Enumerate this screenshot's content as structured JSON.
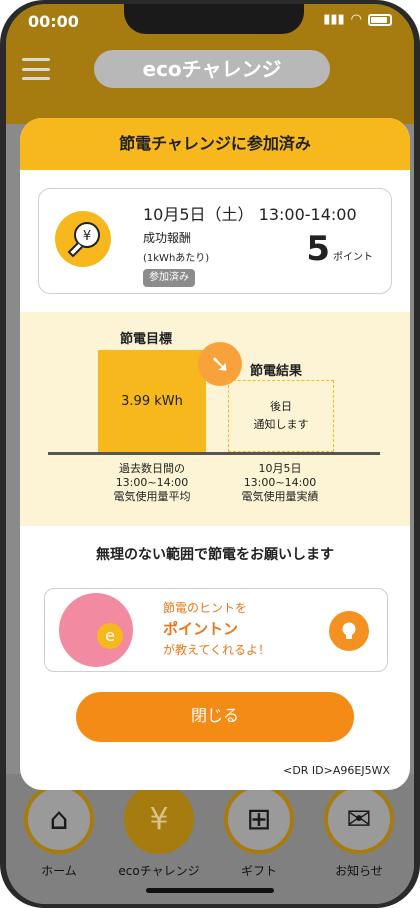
{
  "status": {
    "time": "00:00"
  },
  "header": {
    "title": "ecoチャレンジ"
  },
  "modal": {
    "title": "節電チャレンジに参加済み",
    "event": {
      "date": "10月5日（土）",
      "time": "13:00-14:00",
      "reward_label": "成功報酬",
      "reward_unit": "(1kWhあたり)",
      "status_badge": "参加済み",
      "points": "5",
      "points_unit": "ポイント"
    },
    "goal": {
      "goal_label": "節電目標",
      "goal_value": "3.99 kWh",
      "result_label": "節電結果",
      "result_line1": "後日",
      "result_line2": "通知します",
      "left_caption": [
        "過去数日間の",
        "13:00~14:00",
        "電気使用量平均"
      ],
      "right_caption": [
        "10月5日",
        "13:00~14:00",
        "電気使用量実績"
      ]
    },
    "request": "無理のない範囲で節電をお願いします",
    "tip": {
      "line1": "節電のヒントを",
      "line2": "ポイントン",
      "line3": "が教えてくれるよ！"
    },
    "close_label": "閉じる",
    "dr_id": "<DR ID>A96EJ5WX"
  },
  "nav": {
    "items": [
      {
        "label": "ホーム",
        "icon": "home-icon"
      },
      {
        "label": "ecoチャレンジ",
        "icon": "eco-bulb-icon"
      },
      {
        "label": "ギフト",
        "icon": "gift-icon"
      },
      {
        "label": "お知らせ",
        "icon": "mail-icon"
      }
    ]
  },
  "colors": {
    "accent": "#f6b81c",
    "button": "#f38b14",
    "panel": "#fdf4d6"
  }
}
